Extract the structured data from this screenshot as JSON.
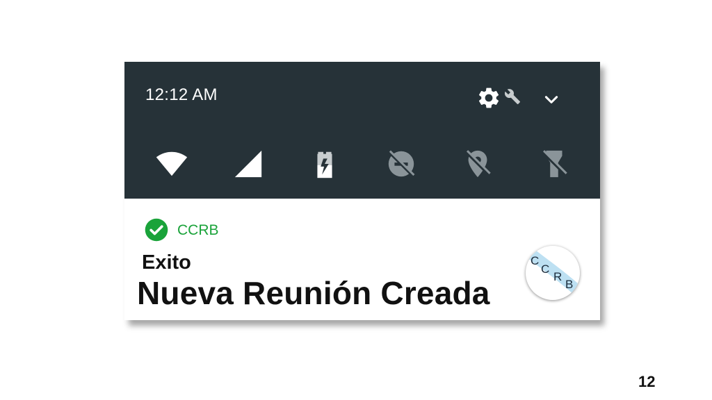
{
  "status_bar": {
    "time": "12:12 AM",
    "background": "#263238",
    "icon_color": "#ffffff",
    "disabled_icon_color": "#8a9499",
    "icons": [
      "settings-gear-icon",
      "wrench-icon",
      "chevron-down-icon"
    ]
  },
  "quick_settings": [
    {
      "name": "wifi",
      "state": "on"
    },
    {
      "name": "cellular-signal",
      "state": "on"
    },
    {
      "name": "battery-charging",
      "state": "on"
    },
    {
      "name": "do-not-disturb",
      "state": "off"
    },
    {
      "name": "location",
      "state": "off"
    },
    {
      "name": "flashlight",
      "state": "off"
    }
  ],
  "notification": {
    "app_name": "CCRB",
    "title": "Exito",
    "text": "Nueva Reunión Creada",
    "accent_color": "#1aa33a",
    "logo_letters": [
      "C",
      "C",
      "R",
      "B"
    ]
  },
  "page_number": "12"
}
